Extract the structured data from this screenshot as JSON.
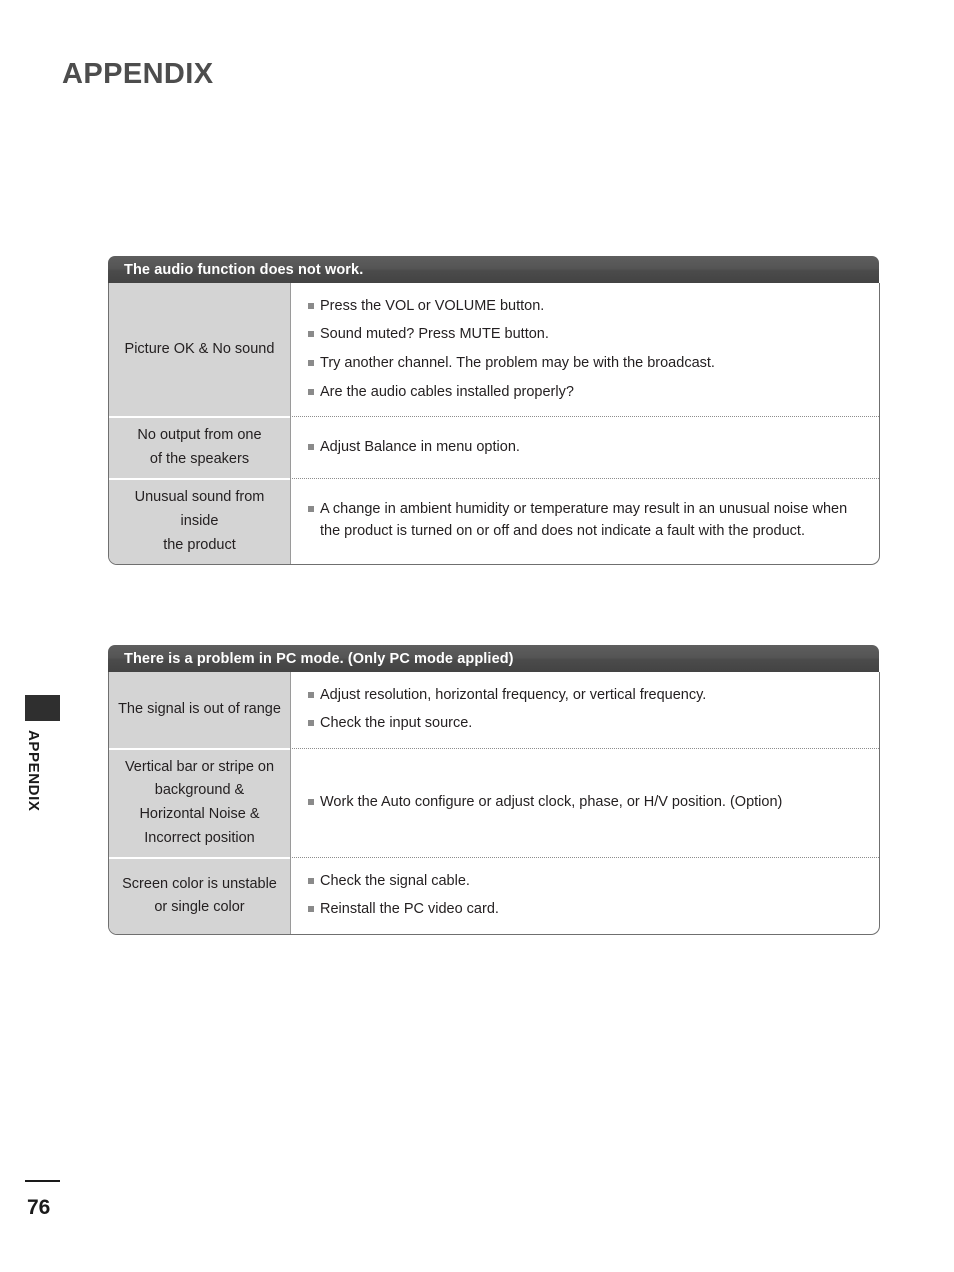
{
  "page": {
    "heading": "APPENDIX",
    "side_label": "APPENDIX",
    "page_number": "76"
  },
  "tables": [
    {
      "title": "The audio function does not work.",
      "rows": [
        {
          "label_lines": [
            "Picture OK & No sound"
          ],
          "bullets": [
            "Press the VOL or VOLUME button.",
            "Sound muted? Press MUTE button.",
            "Try another channel. The problem may be with the broadcast.",
            "Are the audio cables installed properly?"
          ]
        },
        {
          "label_lines": [
            "No output from one",
            "of the speakers"
          ],
          "bullets": [
            "Adjust Balance in menu option."
          ]
        },
        {
          "label_lines": [
            "Unusual sound from",
            "inside",
            "the product"
          ],
          "bullets": [
            "A change in ambient humidity or temperature may result in an unusual noise when the product is turned on or off and does not indicate a fault with the product."
          ]
        }
      ]
    },
    {
      "title": "There is a problem in PC mode. (Only PC mode applied)",
      "rows": [
        {
          "label_lines": [
            "The signal is out of range"
          ],
          "bullets": [
            "Adjust resolution, horizontal frequency, or vertical frequency.",
            "Check the input source."
          ]
        },
        {
          "label_lines": [
            "Vertical bar or stripe on",
            "background &",
            "Horizontal Noise &",
            "Incorrect position"
          ],
          "bullets": [
            "Work the Auto configure or adjust clock, phase, or H/V position. (Option)"
          ]
        },
        {
          "label_lines": [
            "Screen color is unstable",
            "or single color"
          ],
          "bullets": [
            "Check the signal cable.",
            "Reinstall the PC video card."
          ]
        }
      ]
    }
  ],
  "colors": {
    "header_bg": "#4b4b4b",
    "label_bg": "#d4d4d4",
    "bullet": "#8a8a8a",
    "heading_text": "#4d4d4d",
    "tab": "#2f2f2f"
  }
}
